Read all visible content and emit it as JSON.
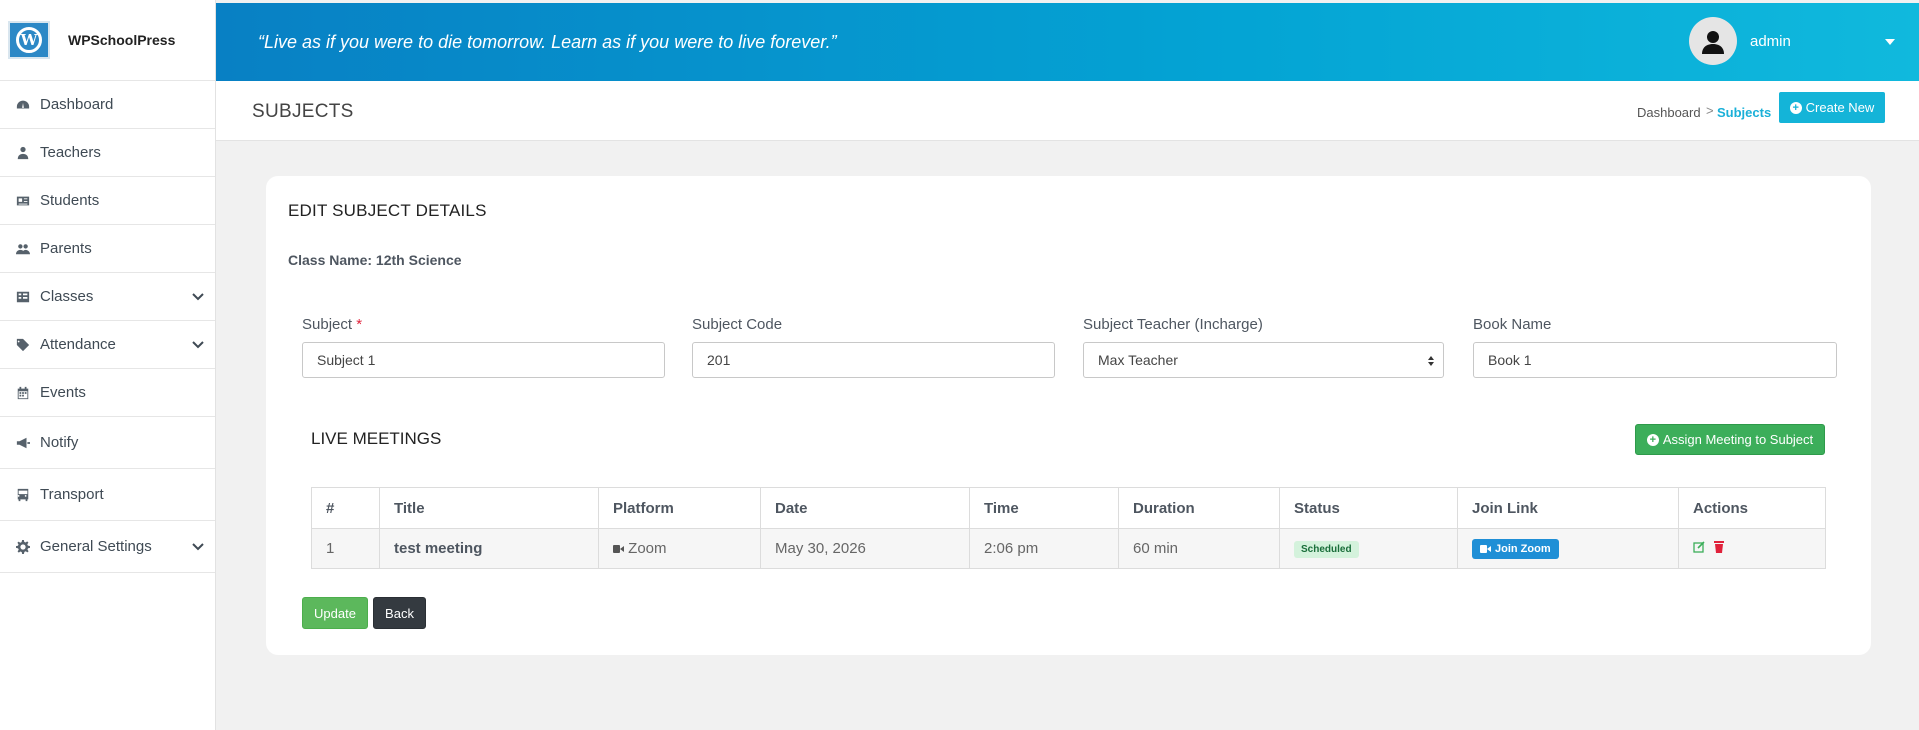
{
  "brand": {
    "name": "WPSchoolPress",
    "logo_letter": "W"
  },
  "sidebar": {
    "items": [
      {
        "label": "Dashboard",
        "icon": "dashboard-icon"
      },
      {
        "label": "Teachers",
        "icon": "teacher-icon"
      },
      {
        "label": "Students",
        "icon": "id-card-icon"
      },
      {
        "label": "Parents",
        "icon": "users-icon"
      },
      {
        "label": "Classes",
        "icon": "table-icon",
        "expandable": true
      },
      {
        "label": "Attendance",
        "icon": "tag-icon",
        "expandable": true
      },
      {
        "label": "Events",
        "icon": "calendar-icon"
      },
      {
        "label": "Notify",
        "icon": "megaphone-icon"
      },
      {
        "label": "Transport",
        "icon": "bus-icon"
      },
      {
        "label": "General Settings",
        "icon": "gear-icon",
        "expandable": true
      }
    ]
  },
  "topbar": {
    "quote": "“Live as if you were to die tomorrow. Learn as if you were to live forever.”",
    "user": "admin"
  },
  "header": {
    "title": "SUBJECTS",
    "breadcrumb_home": "Dashboard",
    "breadcrumb_sep": ">",
    "breadcrumb_current": "Subjects",
    "create_label": "Create New"
  },
  "form": {
    "title": "EDIT SUBJECT DETAILS",
    "class_name": "Class Name: 12th Science",
    "subject_label": "Subject",
    "subject_required": "*",
    "subject_value": "Subject 1",
    "code_label": "Subject Code",
    "code_value": "201",
    "teacher_label": "Subject Teacher (Incharge)",
    "teacher_value": "Max Teacher",
    "book_label": "Book Name",
    "book_value": "Book 1"
  },
  "meetings": {
    "title": "LIVE MEETINGS",
    "assign_label": "Assign Meeting to Subject",
    "columns": [
      "#",
      "Title",
      "Platform",
      "Date",
      "Time",
      "Duration",
      "Status",
      "Join Link",
      "Actions"
    ],
    "rows": [
      {
        "num": "1",
        "title": "test meeting",
        "platform": "Zoom",
        "date": "May 30, 2026",
        "time": "2:06 pm",
        "duration": "60 min",
        "status": "Scheduled",
        "join": "Join Zoom"
      }
    ]
  },
  "buttons": {
    "update": "Update",
    "back": "Back"
  },
  "colors": {
    "accent": "#14b4d8",
    "success": "#3cae5a",
    "topbar_start": "#0880c4",
    "topbar_end": "#10b9dd",
    "danger": "#e0223b"
  }
}
